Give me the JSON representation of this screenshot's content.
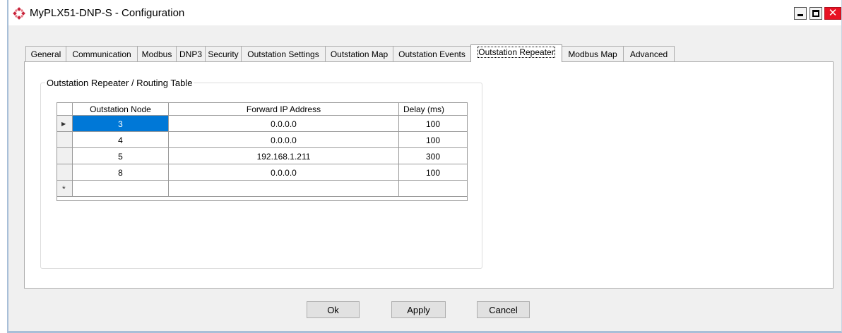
{
  "window": {
    "title": "MyPLX51-DNP-S - Configuration",
    "minimize_icon": "minimize-icon",
    "maximize_icon": "maximize-icon",
    "close_icon": "close-icon",
    "close_glyph": "✕"
  },
  "tabs": [
    {
      "label": "General"
    },
    {
      "label": "Communication"
    },
    {
      "label": "Modbus"
    },
    {
      "label": "DNP3"
    },
    {
      "label": "Security"
    },
    {
      "label": "Outstation Settings"
    },
    {
      "label": "Outstation Map"
    },
    {
      "label": "Outstation Events"
    },
    {
      "label": "Outstation Repeater"
    },
    {
      "label": "Modbus Map"
    },
    {
      "label": "Advanced"
    }
  ],
  "active_tab": "Outstation Repeater",
  "group": {
    "title": "Outstation Repeater / Routing Table"
  },
  "grid": {
    "columns": [
      "Outstation Node",
      "Forward IP Address",
      "Delay (ms)"
    ],
    "rows": [
      {
        "node": "3",
        "ip": "0.0.0.0",
        "delay": "100"
      },
      {
        "node": "4",
        "ip": "0.0.0.0",
        "delay": "100"
      },
      {
        "node": "5",
        "ip": "192.168.1.211",
        "delay": "300"
      },
      {
        "node": "8",
        "ip": "0.0.0.0",
        "delay": "100"
      }
    ],
    "current_row_marker": "▶",
    "new_row_marker": "*"
  },
  "buttons": {
    "ok": "Ok",
    "apply": "Apply",
    "cancel": "Cancel"
  },
  "colors": {
    "selection": "#0078d7",
    "close_button": "#e81123"
  }
}
